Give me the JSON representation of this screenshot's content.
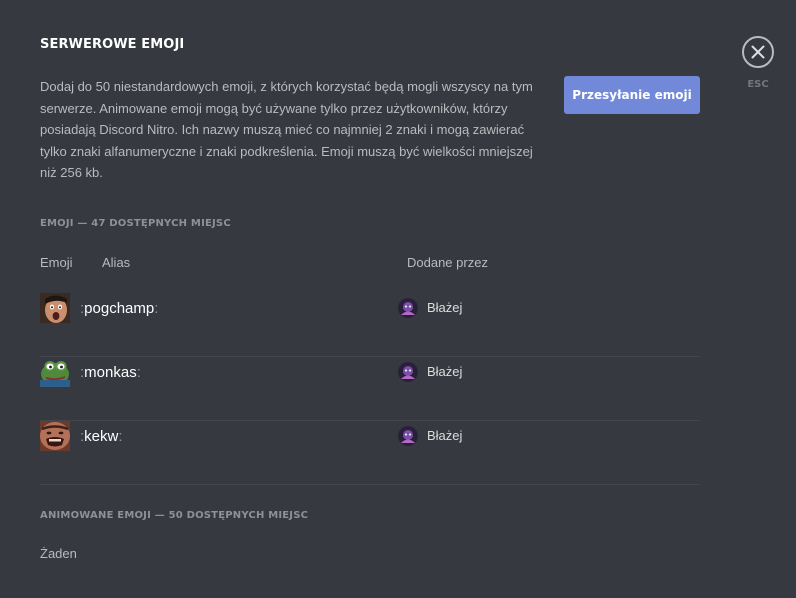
{
  "header": {
    "title": "SERWEROWE EMOJI",
    "description": "Dodaj do 50 niestandardowych emoji, z których korzystać będą mogli wszyscy na tym serwerze. Animowane emoji mogą być używane tylko przez użytkowników, którzy posiadają Discord Nitro. Ich nazwy muszą mieć co najmniej 2 znaki i mogą zawierać tylko znaki alfanumeryczne i znaki podkreślenia. Emoji muszą być wielkości mniejszej niż 256 kb.",
    "upload_label": "Przesyłanie emoji",
    "esc_label": "ESC"
  },
  "emoji_section": {
    "title": "EMOJI — 47 DOSTĘPNYCH MIEJSC",
    "columns": {
      "emoji": "Emoji",
      "alias": "Alias",
      "added_by": "Dodane przez"
    },
    "rows": [
      {
        "alias": "pogchamp",
        "added_by": "Błażej",
        "emoji_icon": "pogchamp-face-icon"
      },
      {
        "alias": "monkas",
        "added_by": "Błażej",
        "emoji_icon": "monkas-frog-icon"
      },
      {
        "alias": "kekw",
        "added_by": "Błażej",
        "emoji_icon": "kekw-face-icon"
      }
    ],
    "colon": ":"
  },
  "animated_section": {
    "title": "ANIMOWANE EMOJI — 50 DOSTĘPNYCH MIEJSC",
    "empty_text": "Żaden"
  },
  "colors": {
    "background": "#36393f",
    "accent": "#7289da",
    "divider": "#42454a"
  }
}
